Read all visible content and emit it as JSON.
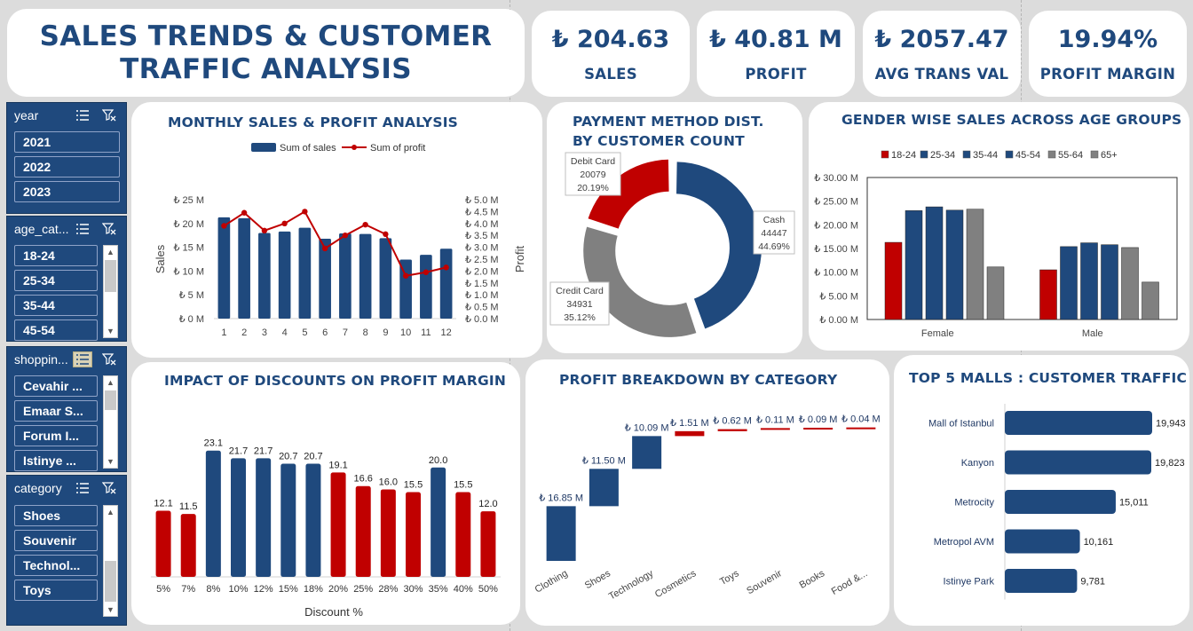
{
  "header": {
    "title_line1": "SALES TRENDS & CUSTOMER",
    "title_line2": "TRAFFIC ANALYSIS"
  },
  "kpis": [
    {
      "value": "₺ 204.63",
      "label": "SALES"
    },
    {
      "value": "₺ 40.81 M",
      "label": "PROFIT"
    },
    {
      "value": "₺ 2057.47",
      "label": "AVG TRANS VAL"
    },
    {
      "value": "19.94%",
      "label": "PROFIT MARGIN"
    }
  ],
  "slicers": {
    "year": {
      "title": "year",
      "items": [
        "2021",
        "2022",
        "2023"
      ]
    },
    "age": {
      "title": "age_cat...",
      "items": [
        "18-24",
        "25-34",
        "35-44",
        "45-54"
      ]
    },
    "shopping": {
      "title": "shoppin...",
      "items": [
        "Cevahir ...",
        "Emaar S...",
        "Forum I...",
        "Istinye ..."
      ]
    },
    "category": {
      "title": "category",
      "items": [
        "Shoes",
        "Souvenir",
        "Technol...",
        "Toys"
      ]
    }
  },
  "colors": {
    "navy": "#1f497d",
    "red": "#c00000",
    "gray": "#808080",
    "text": "#1f3864"
  },
  "chart_data": [
    {
      "id": "monthly",
      "type": "bar+line",
      "title": "MONTHLY SALES & PROFIT ANALYSIS",
      "categories": [
        "1",
        "2",
        "3",
        "4",
        "5",
        "6",
        "7",
        "8",
        "9",
        "10",
        "11",
        "12"
      ],
      "series": [
        {
          "name": "Sum of sales",
          "type": "bar",
          "axis": "left",
          "values": [
            21.3,
            21.1,
            18.0,
            18.3,
            19.1,
            16.8,
            17.9,
            17.8,
            16.9,
            12.4,
            13.4,
            14.7
          ]
        },
        {
          "name": "Sum of profit",
          "type": "line",
          "axis": "right",
          "values": [
            3.9,
            4.45,
            3.7,
            4.0,
            4.5,
            2.95,
            3.5,
            3.95,
            3.55,
            1.8,
            1.95,
            2.15
          ]
        }
      ],
      "ylabel": "Sales",
      "ylabel_right": "Profit",
      "ylim": [
        0,
        25
      ],
      "ylim_right": [
        0,
        5
      ],
      "yticks": [
        "₺ 0 M",
        "₺ 5 M",
        "₺ 10 M",
        "₺ 15 M",
        "₺ 20 M",
        "₺ 25 M"
      ],
      "yticks_right": [
        "₺ 0.0 M",
        "₺ 0.5 M",
        "₺ 1.0 M",
        "₺ 1.5 M",
        "₺ 2.0 M",
        "₺ 2.5 M",
        "₺ 3.0 M",
        "₺ 3.5 M",
        "₺ 4.0 M",
        "₺ 4.5 M",
        "₺ 5.0 M"
      ],
      "legend": "top"
    },
    {
      "id": "payment",
      "type": "pie",
      "title_line1": "PAYMENT METHOD DIST.",
      "title_line2": "BY CUSTOMER COUNT",
      "slices": [
        {
          "name": "Cash",
          "count": "44447",
          "pct": "44.69%",
          "value": 44.69,
          "color": "#1f497d"
        },
        {
          "name": "Credit Card",
          "count": "34931",
          "pct": "35.12%",
          "value": 35.12,
          "color": "#808080"
        },
        {
          "name": "Debit Card",
          "count": "20079",
          "pct": "20.19%",
          "value": 20.19,
          "color": "#c00000"
        }
      ]
    },
    {
      "id": "gender",
      "type": "bar",
      "title": "GENDER WISE SALES ACROSS AGE GROUPS",
      "categories": [
        "Female",
        "Male"
      ],
      "series": [
        {
          "name": "18-24",
          "color": "#c00000",
          "values": [
            16.3,
            10.5
          ]
        },
        {
          "name": "25-34",
          "color": "#1f497d",
          "values": [
            23.0,
            15.4
          ]
        },
        {
          "name": "35-44",
          "color": "#1f497d",
          "values": [
            23.8,
            16.2
          ]
        },
        {
          "name": "45-54",
          "color": "#1f497d",
          "values": [
            23.1,
            15.8
          ]
        },
        {
          "name": "55-64",
          "color": "#808080",
          "values": [
            23.3,
            15.2
          ]
        },
        {
          "name": "65+",
          "color": "#808080",
          "values": [
            11.1,
            7.9
          ]
        }
      ],
      "ylim": [
        0,
        30
      ],
      "yticks": [
        "₺ 0.00 M",
        "₺ 5.00 M",
        "₺ 10.00 M",
        "₺ 15.00 M",
        "₺ 20.00 M",
        "₺ 25.00 M",
        "₺ 30.00 M"
      ],
      "legend": "top"
    },
    {
      "id": "discount",
      "type": "bar",
      "title": "IMPACT OF DISCOUNTS ON PROFIT MARGIN",
      "categories": [
        "5%",
        "7%",
        "8%",
        "10%",
        "12%",
        "15%",
        "18%",
        "20%",
        "25%",
        "28%",
        "30%",
        "35%",
        "40%",
        "50%"
      ],
      "values": [
        12.1,
        11.5,
        23.1,
        21.7,
        21.7,
        20.7,
        20.7,
        19.1,
        16.6,
        16.0,
        15.5,
        20.0,
        15.5,
        12.0
      ],
      "labels": [
        "12.1",
        "11.5",
        "23.1",
        "21.7",
        "21.7",
        "20.7",
        "20.7",
        "19.1",
        "16.6",
        "16.0",
        "15.5",
        "20.0",
        "15.5",
        "12.0"
      ],
      "colors": [
        "#c00000",
        "#c00000",
        "#1f497d",
        "#1f497d",
        "#1f497d",
        "#1f497d",
        "#1f497d",
        "#c00000",
        "#c00000",
        "#c00000",
        "#c00000",
        "#1f497d",
        "#c00000",
        "#c00000"
      ],
      "xlabel": "Discount %",
      "ylim": [
        0,
        25
      ]
    },
    {
      "id": "waterfall",
      "type": "waterfall",
      "title": "PROFIT BREAKDOWN BY CATEGORY",
      "categories": [
        "Clothing",
        "Shoes",
        "Technology",
        "Cosmetics",
        "Toys",
        "Souvenir",
        "Books",
        "Food &..."
      ],
      "values": [
        16.85,
        11.5,
        10.09,
        1.51,
        0.62,
        0.11,
        0.09,
        0.04
      ],
      "labels": [
        "₺ 16.85 M",
        "₺ 11.50 M",
        "₺ 10.09 M",
        "₺ 1.51 M",
        "₺ 0.62 M",
        "₺ 0.11 M",
        "₺ 0.09 M",
        "₺ 0.04 M"
      ],
      "colors": [
        "#1f497d",
        "#1f497d",
        "#1f497d",
        "#c00000",
        "#c00000",
        "#c00000",
        "#c00000",
        "#c00000"
      ]
    },
    {
      "id": "malls",
      "type": "bar-horizontal",
      "title": "TOP 5 MALLS : CUSTOMER TRAFFIC",
      "categories": [
        "Mall of Istanbul",
        "Kanyon",
        "Metrocity",
        "Metropol AVM",
        "Istinye Park"
      ],
      "values": [
        19943,
        19823,
        15011,
        10161,
        9781
      ],
      "labels": [
        "19,943",
        "19,823",
        "15,011",
        "10,161",
        "9,781"
      ]
    }
  ]
}
